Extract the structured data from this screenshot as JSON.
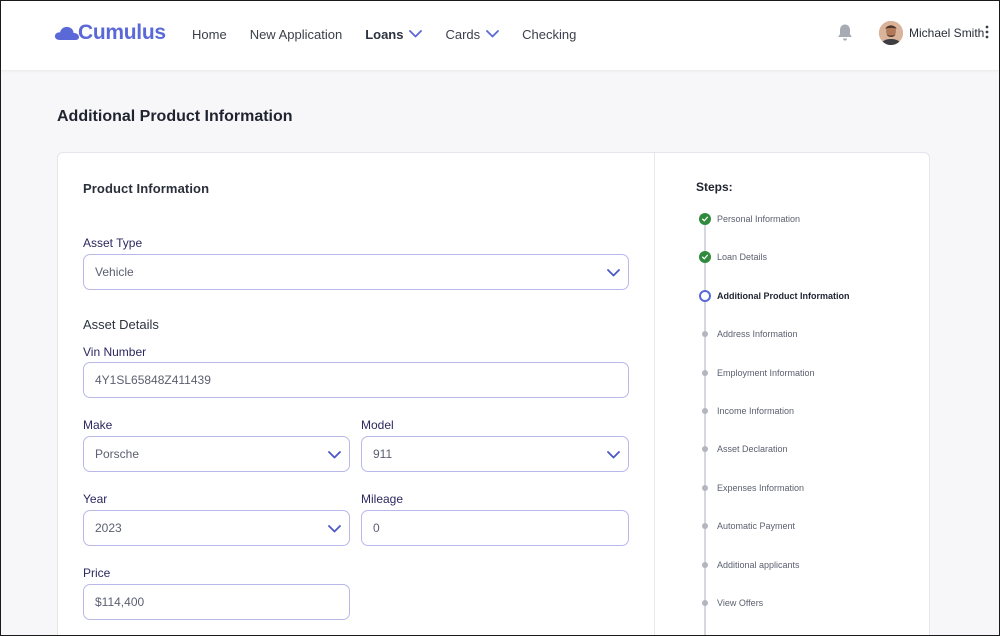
{
  "header": {
    "logo_text": "Cumulus",
    "nav": [
      {
        "label": "Home",
        "dropdown": false,
        "bold": false
      },
      {
        "label": "New Application",
        "dropdown": false,
        "bold": false
      },
      {
        "label": "Loans",
        "dropdown": true,
        "bold": true
      },
      {
        "label": "Cards",
        "dropdown": true,
        "bold": false
      },
      {
        "label": "Checking",
        "dropdown": false,
        "bold": false
      }
    ],
    "user_name": "Michael Smith",
    "icons": {
      "notifications": "bell-icon",
      "menu": "kebab-icon"
    }
  },
  "page": {
    "title": "Additional Product Information"
  },
  "form": {
    "section_title": "Product Information",
    "asset_type": {
      "label": "Asset Type",
      "value": "Vehicle"
    },
    "asset_details_heading": "Asset Details",
    "vin": {
      "label": "Vin Number",
      "value": "4Y1SL65848Z411439"
    },
    "make": {
      "label": "Make",
      "value": "Porsche"
    },
    "model": {
      "label": "Model",
      "value": "911"
    },
    "year": {
      "label": "Year",
      "value": "2023"
    },
    "mileage": {
      "label": "Mileage",
      "value": "0"
    },
    "price": {
      "label": "Price",
      "value": "$114,400"
    }
  },
  "steps": {
    "title": "Steps:",
    "items": [
      {
        "label": "Personal Information",
        "status": "done"
      },
      {
        "label": "Loan Details",
        "status": "done"
      },
      {
        "label": "Additional Product Information",
        "status": "current"
      },
      {
        "label": "Address Information",
        "status": "todo"
      },
      {
        "label": "Employment Information",
        "status": "todo"
      },
      {
        "label": "Income Information",
        "status": "todo"
      },
      {
        "label": "Asset Declaration",
        "status": "todo"
      },
      {
        "label": "Expenses Information",
        "status": "todo"
      },
      {
        "label": "Automatic Payment",
        "status": "todo"
      },
      {
        "label": "Additional applicants",
        "status": "todo"
      },
      {
        "label": "View Offers",
        "status": "todo"
      }
    ]
  },
  "colors": {
    "brand": "#5b68d8",
    "field_border": "#b9b8ea",
    "done": "#2f8a3c",
    "label": "#2c2860"
  }
}
